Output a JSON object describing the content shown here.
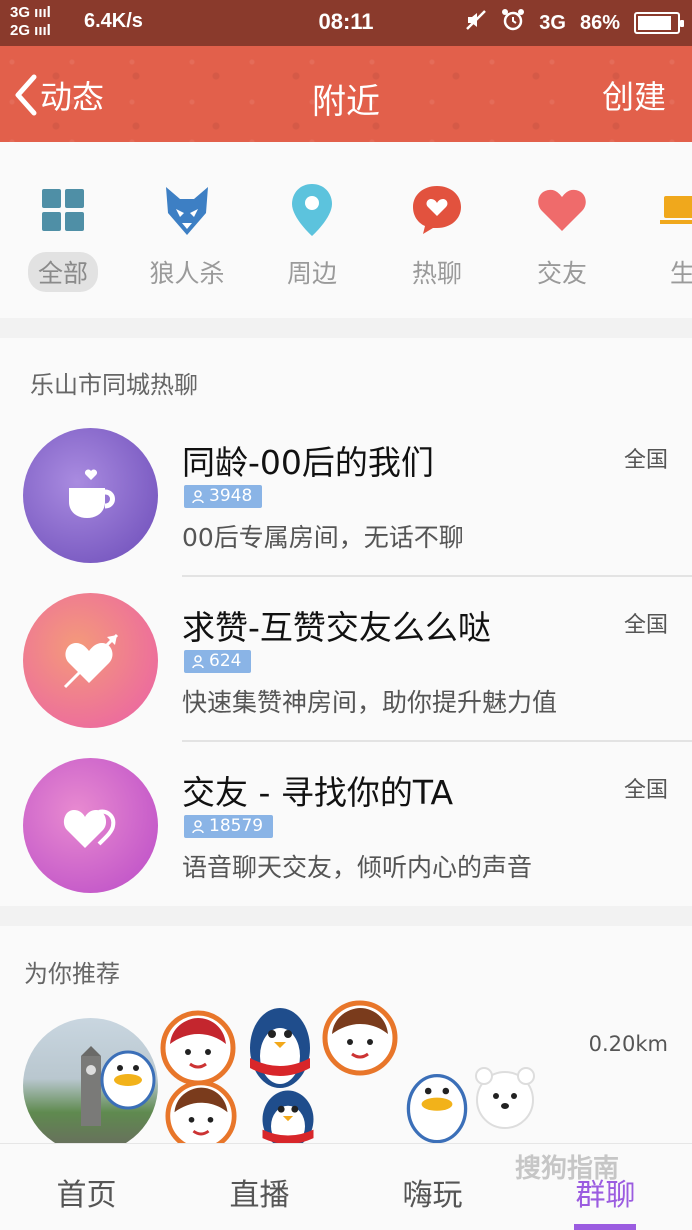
{
  "status_bar": {
    "network_top": "3G",
    "network_bottom": "2G",
    "speed": "6.4K/s",
    "time": "08:11",
    "network_right": "3G",
    "battery": "86%",
    "battery_level": 0.86
  },
  "header": {
    "back_label": "动态",
    "title": "附近",
    "create_label": "创建",
    "bg_color": "#e2604b"
  },
  "categories": [
    {
      "label": "全部",
      "icon": "grid-icon",
      "active": true
    },
    {
      "label": "狼人杀",
      "icon": "wolf-icon",
      "active": false
    },
    {
      "label": "周边",
      "icon": "location-pin-icon",
      "active": false
    },
    {
      "label": "热聊",
      "icon": "chat-heart-icon",
      "active": false
    },
    {
      "label": "交友",
      "icon": "heart-icon",
      "active": false
    },
    {
      "label": "生活",
      "icon": "life-icon",
      "active": false
    }
  ],
  "hot_chat": {
    "title": "乐山市同城热聊",
    "rooms": [
      {
        "name": "同龄-00后的我们",
        "members": "3948",
        "desc": "00后专属房间，无话不聊",
        "scope": "全国"
      },
      {
        "name": "求赞-互赞交友么么哒",
        "members": "624",
        "desc": "快速集赞神房间，助你提升魅力值",
        "scope": "全国"
      },
      {
        "name": "交友 - 寻找你的TA",
        "members": "18579",
        "desc": "语音聊天交友，倾听内心的声音",
        "scope": "全国"
      }
    ]
  },
  "recommend": {
    "title": "为你推荐",
    "distance": "0.20km"
  },
  "bottom_nav": [
    {
      "label": "首页",
      "active": false
    },
    {
      "label": "直播",
      "active": false
    },
    {
      "label": "嗨玩",
      "active": false
    },
    {
      "label": "群聊",
      "active": true
    }
  ],
  "watermark": "搜狗指南",
  "colors": {
    "accent": "#9b5ce0",
    "badge": "#8ab4e6"
  }
}
